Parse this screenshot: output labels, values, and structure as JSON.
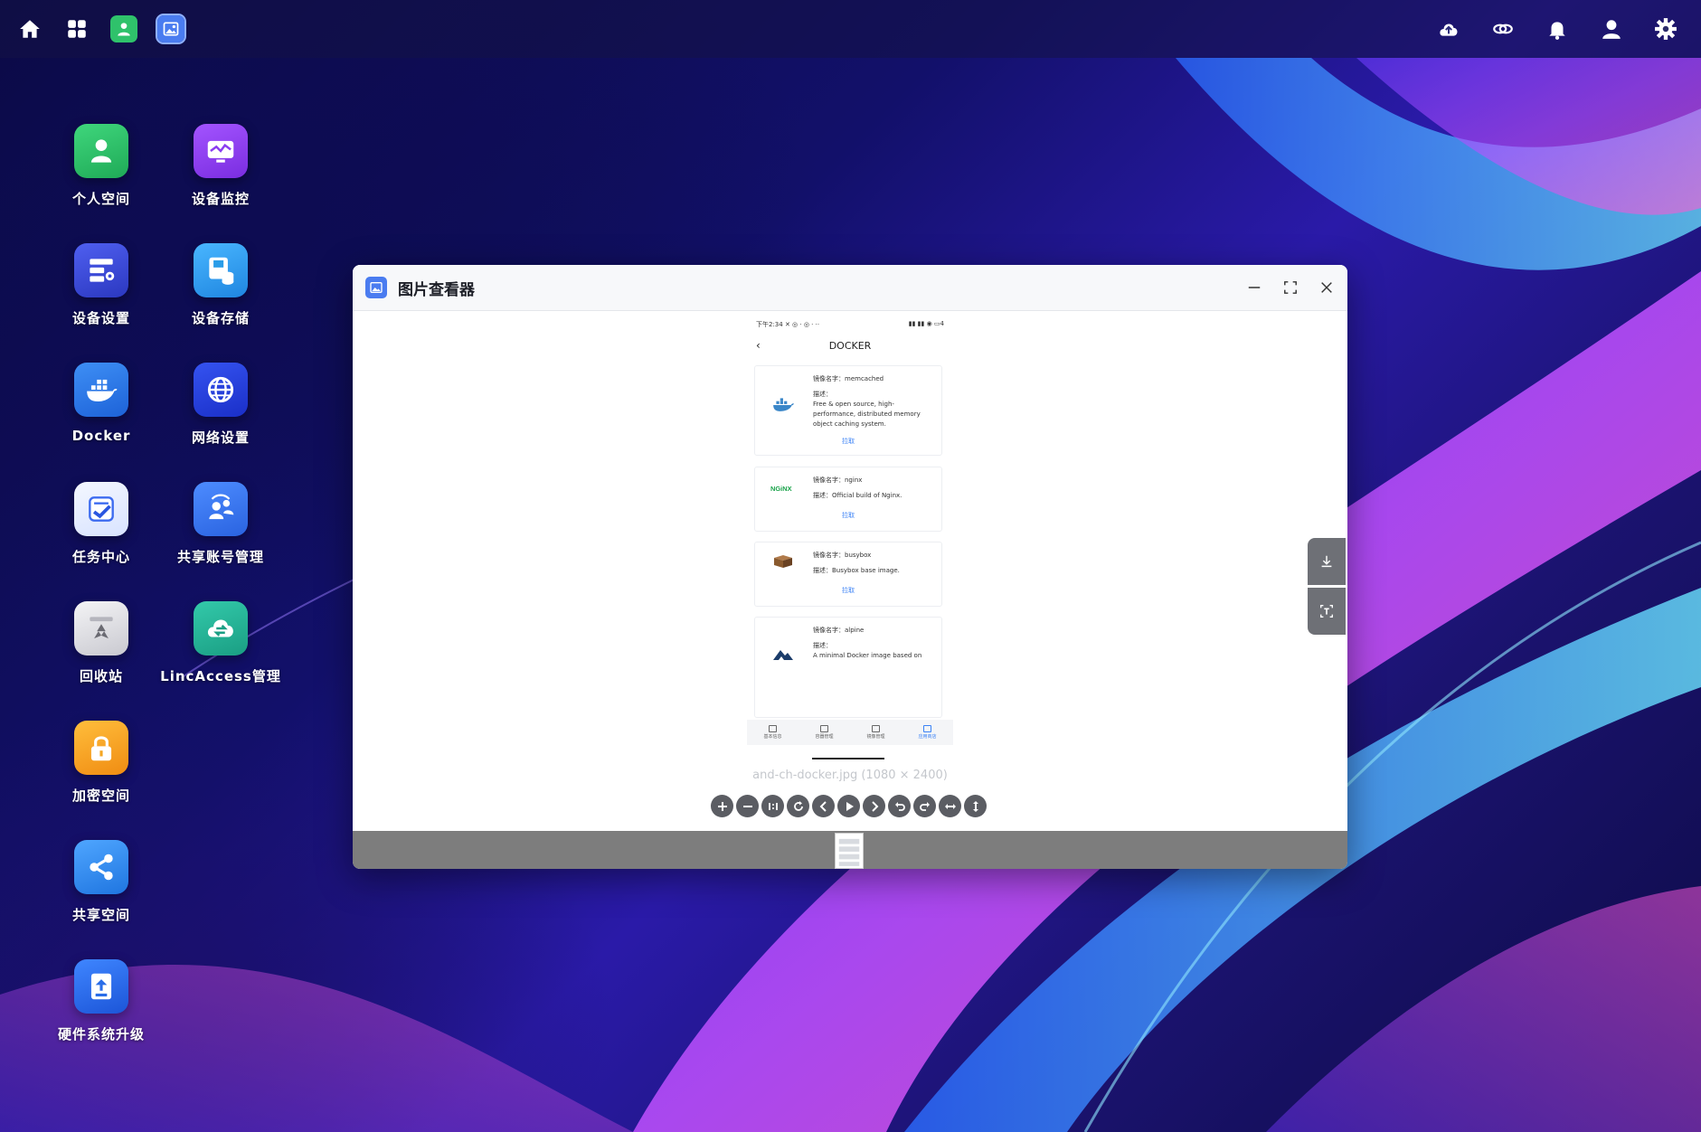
{
  "topbar": {
    "left_icons": [
      "home-icon",
      "grid-apps-icon",
      "personal-space-app-icon",
      "image-viewer-app-icon"
    ],
    "right_icons": [
      "cloud-sync-icon",
      "link-icon",
      "bell-icon",
      "user-icon",
      "gear-icon"
    ]
  },
  "desktop": {
    "icons": [
      {
        "label": "个人空间",
        "icon": "person-icon",
        "color": "#2fc26b"
      },
      {
        "label": "设备监控",
        "icon": "monitor-chart-icon",
        "color": "#8b3ef0"
      },
      {
        "label": "设备设置",
        "icon": "server-settings-icon",
        "color": "#3b4ad8"
      },
      {
        "label": "设备存储",
        "icon": "storage-icon",
        "color": "#2a9de8"
      },
      {
        "label": "Docker",
        "icon": "docker-whale-icon",
        "color": "#2a7de8"
      },
      {
        "label": "网络设置",
        "icon": "globe-network-icon",
        "color": "#2640d8"
      },
      {
        "label": "任务中心",
        "icon": "task-check-icon",
        "color": "#e8f0ff"
      },
      {
        "label": "共享账号管理",
        "icon": "shared-accounts-icon",
        "color": "#3c7bf0"
      },
      {
        "label": "回收站",
        "icon": "recycle-bin-icon",
        "color": "#e8e8ec"
      },
      {
        "label": "LincAccess管理",
        "icon": "cloud-transfer-icon",
        "color": "#27b59a"
      },
      {
        "label": "加密空间",
        "icon": "lock-icon",
        "color": "#f5a623"
      },
      {
        "label": "共享空间",
        "icon": "share-icon",
        "color": "#2a8cf0"
      },
      {
        "label": "硬件系统升级",
        "icon": "upgrade-icon",
        "color": "#2a6de8"
      }
    ]
  },
  "viewer": {
    "title": "图片查看器",
    "filename": "and-ch-docker.jpg (1080 × 2400)",
    "toolbar_icons": [
      "zoom-in-icon",
      "zoom-out-icon",
      "one-to-one-icon",
      "reset-icon",
      "prev-icon",
      "play-icon",
      "next-icon",
      "rotate-left-icon",
      "rotate-right-icon",
      "flip-horizontal-icon",
      "flip-vertical-icon"
    ],
    "side_tools": [
      "download-icon",
      "ocr-text-icon"
    ]
  },
  "shot": {
    "status_left": "下午2:34 ✕ ◎ · ◎ · ··",
    "status_right": "▮▮ ▮▮ ◉ ▭4",
    "header": "DOCKER",
    "cards": [
      {
        "name_label": "镜像名字：",
        "name": "memcached",
        "desc_label": "描述：",
        "desc": "Free & open source, high-performance, distributed memory object caching system.",
        "action": "拉取",
        "logo": "docker-whale-logo"
      },
      {
        "name_label": "镜像名字：",
        "name": "nginx",
        "desc_label": "描述：",
        "desc": "Official build of Nginx.",
        "action": "拉取",
        "logo": "nginx-logo"
      },
      {
        "name_label": "镜像名字：",
        "name": "busybox",
        "desc_label": "描述：",
        "desc": "Busybox base image.",
        "action": "拉取",
        "logo": "busybox-box-logo"
      },
      {
        "name_label": "镜像名字：",
        "name": "alpine",
        "desc_label": "描述：",
        "desc": "A minimal Docker image based on",
        "action": "",
        "logo": "alpine-mountain-logo"
      }
    ],
    "tabs": [
      {
        "label": "基本信息",
        "active": false
      },
      {
        "label": "容器管理",
        "active": false
      },
      {
        "label": "镜像管理",
        "active": false
      },
      {
        "label": "应用商店",
        "active": true
      }
    ]
  }
}
